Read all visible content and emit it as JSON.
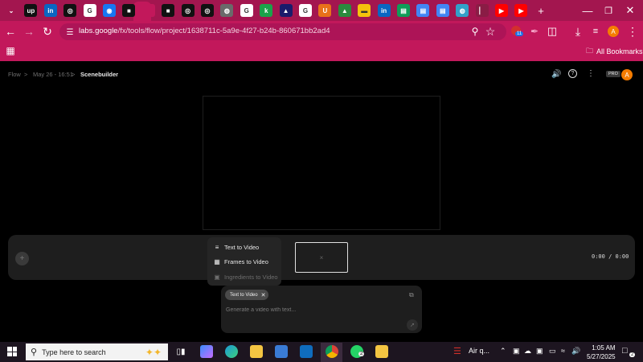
{
  "browser": {
    "tabs": [
      {
        "icon": "chevron-down-icon",
        "color": "#a3164f"
      },
      {
        "icon": "upwork-icon",
        "color": "#111111"
      },
      {
        "icon": "linkedin-icon",
        "color": "#0a66c2"
      },
      {
        "icon": "chatgpt-icon",
        "color": "#111111"
      },
      {
        "icon": "google-icon",
        "color": "#ffffff"
      },
      {
        "icon": "meta-icon",
        "color": "#1877f2"
      },
      {
        "icon": "black-tab-icon",
        "color": "#111111"
      },
      {
        "icon": "close-icon",
        "color": "#c2185b"
      },
      {
        "icon": "black-tab-icon",
        "color": "#111111"
      },
      {
        "icon": "chatgpt-icon",
        "color": "#111111"
      },
      {
        "icon": "chatgpt-icon",
        "color": "#111111"
      },
      {
        "icon": "globe-icon",
        "color": "#6a6a6a"
      },
      {
        "icon": "google-icon",
        "color": "#ffffff"
      },
      {
        "icon": "green-k-icon",
        "color": "#1aa34a"
      },
      {
        "icon": "triangle-icon",
        "color": "#1b1b6b"
      },
      {
        "icon": "google-icon",
        "color": "#ffffff"
      },
      {
        "icon": "orange-u-icon",
        "color": "#e8711a"
      },
      {
        "icon": "drive-icon",
        "color": "#2b8a3e"
      },
      {
        "icon": "keep-icon",
        "color": "#f4c20d"
      },
      {
        "icon": "linkedin-icon",
        "color": "#0a66c2"
      },
      {
        "icon": "sheets-icon",
        "color": "#0f9d58"
      },
      {
        "icon": "docs-icon",
        "color": "#4285f4"
      },
      {
        "icon": "docs-icon",
        "color": "#4285f4"
      },
      {
        "icon": "edge-icon",
        "color": "#33a0c8"
      },
      {
        "icon": "pin-icon",
        "color": "#8a1c45"
      },
      {
        "icon": "youtube-icon",
        "color": "#ff0000"
      },
      {
        "icon": "youtube-icon",
        "color": "#ff0000"
      }
    ],
    "tab_fav_labels": [
      "⌄",
      "up",
      "in",
      "◎",
      "G",
      "◉",
      "■",
      "",
      "■",
      "◎",
      "◎",
      "◍",
      "G",
      "k",
      "▲",
      "G",
      "U",
      "▲",
      "▬",
      "in",
      "▤",
      "▤",
      "▤",
      "◍",
      "▏",
      "▶",
      "▶"
    ],
    "new_tab_icon": "+",
    "url_host": "labs.google",
    "url_path": "/fx/tools/flow/project/1638711c-5a9e-4f27-b24b-860671bb2ad4",
    "extension_badge": "11",
    "profile_initial": "A",
    "bookmarks_label": "All Bookmarks"
  },
  "app": {
    "breadcrumb": {
      "root": "Flow",
      "project": "May 26 - 16:51",
      "current": "Scenebuilder"
    },
    "pro_badge": "PRO",
    "avatar_initial": "A",
    "menu": {
      "text_to_video": "Text to Video",
      "frames_to_video": "Frames to Video",
      "ingredients_to_video": "Ingredients to Video"
    },
    "timecode": "0:00 / 0:00",
    "prompt": {
      "mode_chip": "Text to Video",
      "placeholder": "Generate a video with text..."
    }
  },
  "taskbar": {
    "search_placeholder": "Type here to search",
    "whatsapp_badge": "2",
    "weather": "Air q...",
    "time": "1:05 AM",
    "date": "5/27/2025",
    "notification_count": "2"
  }
}
